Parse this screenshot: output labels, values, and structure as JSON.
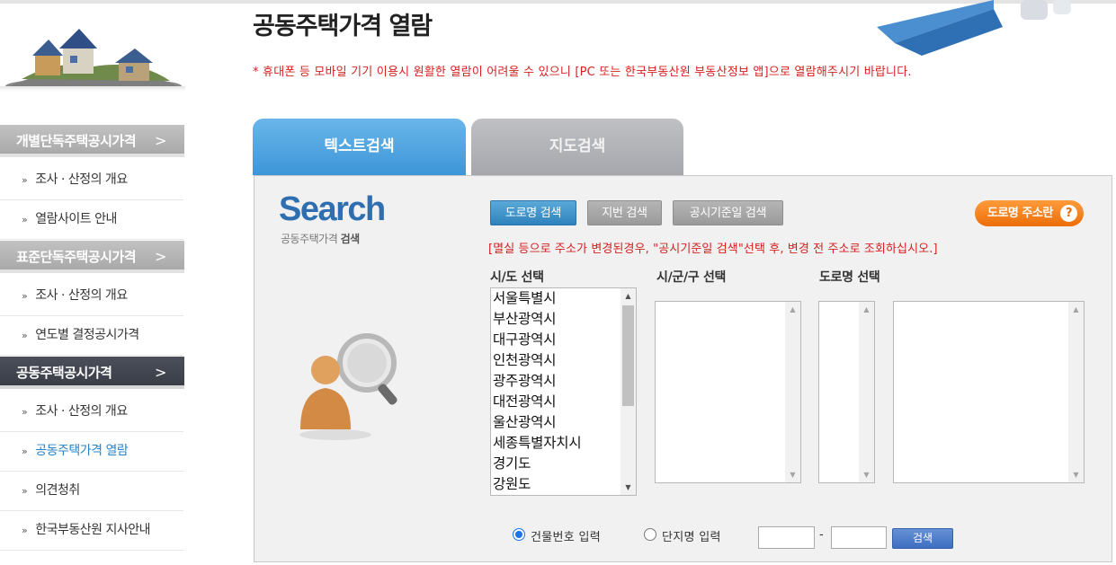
{
  "page": {
    "title": "공동주택가격 열람",
    "notice": "* 휴대폰 등 모바일 기기 이용시 원활한 열람이 어려울 수 있으니 [PC 또는 한국부동산원 부동산정보 앱]으로 열람해주시기 바랍니다."
  },
  "sidebar": {
    "categories": [
      {
        "label": "개별단독주택공시가격",
        "arrow": ">"
      },
      {
        "label": "표준단독주택공시가격",
        "arrow": ">"
      },
      {
        "label": "공동주택공시가격",
        "arrow": ">"
      }
    ],
    "items": [
      {
        "label": "조사 · 산정의 개요"
      },
      {
        "label": "열람사이트 안내"
      },
      {
        "label": "조사 · 산정의 개요"
      },
      {
        "label": "연도별 결정공시가격"
      },
      {
        "label": "조사 · 산정의 개요"
      },
      {
        "label": "공동주택가격 열람"
      },
      {
        "label": "의견청취"
      },
      {
        "label": "한국부동산원 지사안내"
      }
    ],
    "marker": "»"
  },
  "tabs": {
    "text_search": "텍스트검색",
    "map_search": "지도검색"
  },
  "panel": {
    "search_word": "Search",
    "search_sub_plain": "공동주택가격 ",
    "search_sub_bold": "검색",
    "buttons": {
      "road": "도로명 검색",
      "lot": "지번 검색",
      "date": "공시기준일 검색",
      "road_info": "도로명 주소란",
      "help_icon": "?"
    },
    "warning": "[멸실 등으로 주소가 변경된경우, \"공시기준일 검색\"선택 후, 변경 전 주소로 조회하십시오.]",
    "labels": {
      "sido": "시/도 선택",
      "sigungu": "시/군/구 선택",
      "road": "도로명 선택"
    },
    "sido_options": [
      "서울특별시",
      "부산광역시",
      "대구광역시",
      "인천광역시",
      "광주광역시",
      "대전광역시",
      "울산광역시",
      "세종특별자치시",
      "경기도",
      "강원도"
    ],
    "radios": {
      "building_no": "건물번호 입력",
      "complex_name": "단지명 입력",
      "selected": "building_no"
    },
    "dash": "-",
    "go": "검색"
  },
  "colors": {
    "accent": "#3d96d8",
    "notice": "#d52020",
    "orange": "#ec6e09"
  }
}
